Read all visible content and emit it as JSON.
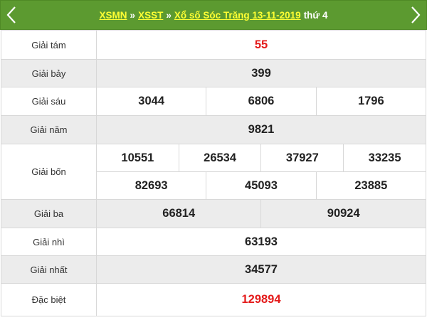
{
  "header": {
    "link_xsmn": "XSMN",
    "link_xsst": "XSST",
    "separator": "»",
    "link_title": "Xổ số Sóc Trăng 13-11-2019",
    "weekday": "thứ 4"
  },
  "prizes": {
    "giai_tam": {
      "label": "Giải tám",
      "numbers": [
        "55"
      ]
    },
    "giai_bay": {
      "label": "Giải bảy",
      "numbers": [
        "399"
      ]
    },
    "giai_sau": {
      "label": "Giải sáu",
      "numbers": [
        "3044",
        "6806",
        "1796"
      ]
    },
    "giai_nam": {
      "label": "Giải năm",
      "numbers": [
        "9821"
      ]
    },
    "giai_bon": {
      "label": "Giải bốn",
      "numbers": [
        "10551",
        "26534",
        "37927",
        "33235",
        "82693",
        "45093",
        "23885"
      ]
    },
    "giai_ba": {
      "label": "Giải ba",
      "numbers": [
        "66814",
        "90924"
      ]
    },
    "giai_nhi": {
      "label": "Giải nhì",
      "numbers": [
        "63193"
      ]
    },
    "giai_nhat": {
      "label": "Giải nhất",
      "numbers": [
        "34577"
      ]
    },
    "dac_biet": {
      "label": "Đặc biệt",
      "numbers": [
        "129894"
      ]
    }
  },
  "colors": {
    "header_bg": "#5c9a30",
    "header_link": "#ffff33",
    "highlight_number": "#e41b1b",
    "row_alt_bg": "#ececec"
  },
  "icons": {
    "prev": "chevron-left-icon",
    "next": "chevron-right-icon"
  }
}
